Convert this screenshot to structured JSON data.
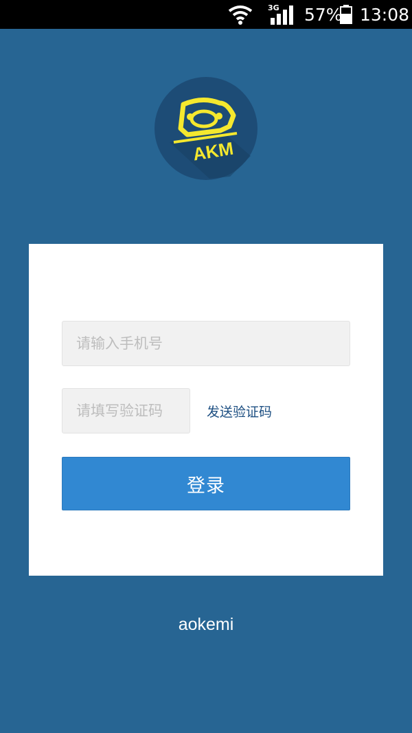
{
  "status_bar": {
    "network_type": "3G",
    "battery_percent": "57%",
    "time": "13:08",
    "icons": [
      "wifi-icon",
      "signal-icon",
      "battery-icon"
    ]
  },
  "logo": {
    "text": "AKM",
    "icon": "akm-logo-icon",
    "colors": {
      "circle": "#1d4c76",
      "accent": "#f5e82e"
    }
  },
  "login_form": {
    "phone_placeholder": "请输入手机号",
    "phone_value": "",
    "code_placeholder": "请填写验证码",
    "code_value": "",
    "send_code_label": "发送验证码",
    "login_label": "登录"
  },
  "footer": {
    "brand": "aokemi"
  },
  "colors": {
    "background": "#276593",
    "card": "#ffffff",
    "button": "#3188d2",
    "link": "#1d4f82"
  }
}
